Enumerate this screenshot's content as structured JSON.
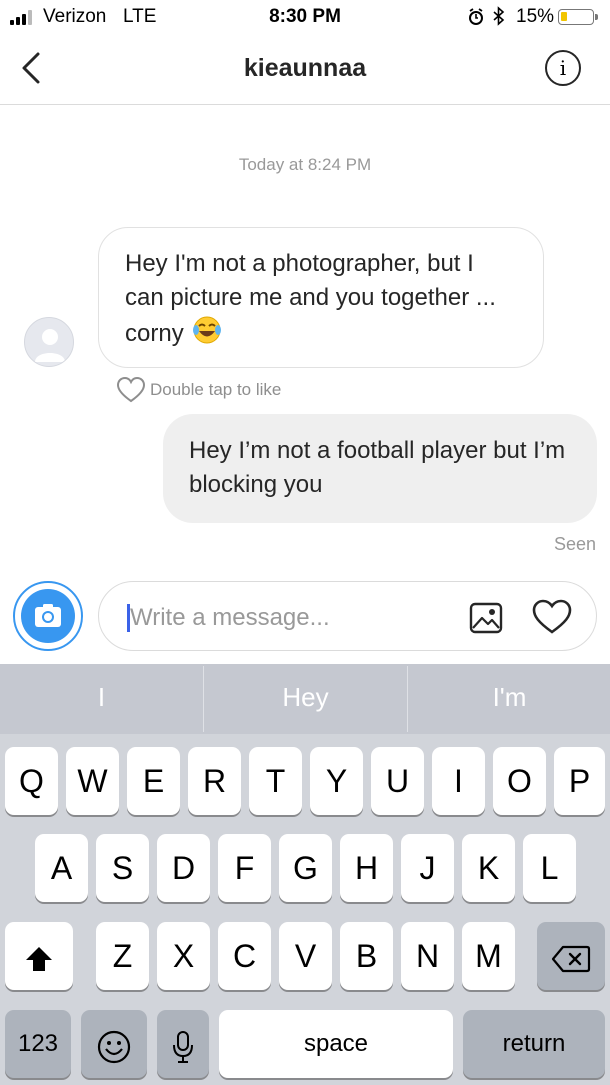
{
  "status_bar": {
    "carrier": "Verizon",
    "network": "LTE",
    "time": "8:30 PM",
    "battery": "15%",
    "icons": [
      "signal-icon",
      "alarm-icon",
      "bluetooth-icon",
      "battery-icon"
    ]
  },
  "header": {
    "title": "kieaunnaa",
    "info_label": "i"
  },
  "conversation": {
    "timestamp": "Today at 8:24 PM",
    "incoming_text": "Hey I'm not a photographer, but I can picture me and you together ... corny",
    "incoming_emoji": "face-with-tears-of-joy",
    "like_hint": "Double tap to like",
    "outgoing_text": "Hey I’m not a football player but I’m blocking you",
    "seen_label": "Seen"
  },
  "composer": {
    "placeholder": "Write a message..."
  },
  "keyboard": {
    "predictions": [
      "I",
      "Hey",
      "I'm"
    ],
    "row1": [
      "Q",
      "W",
      "E",
      "R",
      "T",
      "Y",
      "U",
      "I",
      "O",
      "P"
    ],
    "row2": [
      "A",
      "S",
      "D",
      "F",
      "G",
      "H",
      "J",
      "K",
      "L"
    ],
    "row3": [
      "Z",
      "X",
      "C",
      "V",
      "B",
      "N",
      "M"
    ],
    "numbers_key": "123",
    "space_key": "space",
    "return_key": "return"
  },
  "colors": {
    "accent": "#3897f0",
    "incoming_border": "#e1e1e1",
    "outgoing_bg": "#efefef",
    "keyboard_bg": "#d1d4da",
    "battery_low": "#f2c500"
  }
}
